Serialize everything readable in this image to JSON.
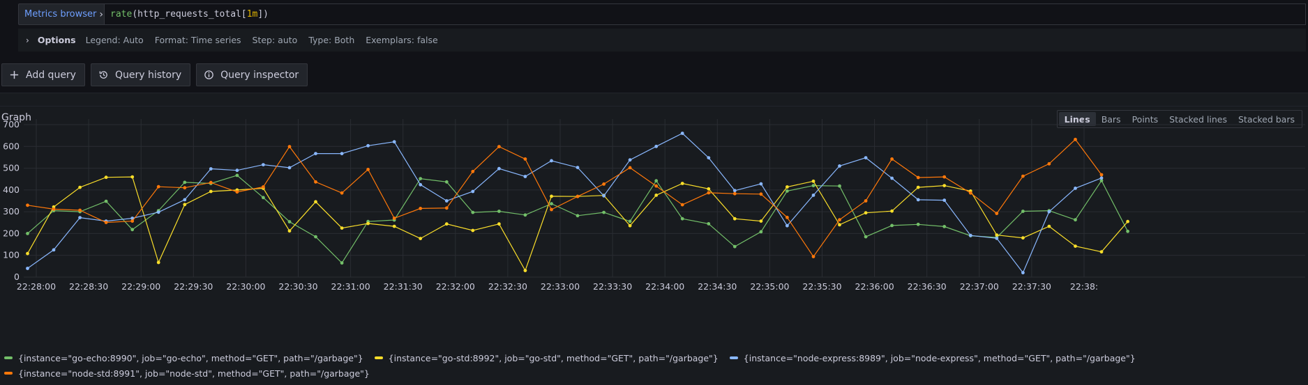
{
  "query": {
    "metrics_browser_label": "Metrics browser",
    "expr_fn": "rate",
    "expr_open": "(http_requests_total[",
    "expr_num": "1m",
    "expr_close": "])"
  },
  "options": {
    "title": "Options",
    "legend": "Legend: Auto",
    "format": "Format: Time series",
    "step": "Step: auto",
    "type": "Type: Both",
    "exemplars": "Exemplars: false"
  },
  "buttons": {
    "add_query": "Add query",
    "query_history": "Query history",
    "query_inspector": "Query inspector"
  },
  "graph": {
    "title": "Graph",
    "modes": [
      "Lines",
      "Bars",
      "Points",
      "Stacked lines",
      "Stacked bars"
    ],
    "active_mode": "Lines"
  },
  "colors": {
    "green": "#73bf69",
    "yellow": "#fade2a",
    "blue": "#8ab8ff",
    "orange": "#ff780a"
  },
  "chart_data": {
    "type": "line",
    "ylim": [
      0,
      700
    ],
    "yticks": [
      0,
      100,
      200,
      300,
      400,
      500,
      600,
      700
    ],
    "x_start": "22:27:55",
    "x_step_seconds": 15,
    "xtick_labels": [
      "22:28:00",
      "22:28:30",
      "22:29:00",
      "22:29:30",
      "22:30:00",
      "22:30:30",
      "22:31:00",
      "22:31:30",
      "22:32:00",
      "22:32:30",
      "22:33:00",
      "22:33:30",
      "22:34:00",
      "22:34:30",
      "22:35:00",
      "22:35:30",
      "22:36:00",
      "22:36:30",
      "22:37:00",
      "22:37:30",
      "22:38:00"
    ],
    "xtick_display": [
      "22:28:00",
      "22:28:30",
      "22:29:00",
      "22:29:30",
      "22:30:00",
      "22:30:30",
      "22:31:00",
      "22:31:30",
      "22:32:00",
      "22:32:30",
      "22:33:00",
      "22:33:30",
      "22:34:00",
      "22:34:30",
      "22:35:00",
      "22:35:30",
      "22:36:00",
      "22:36:30",
      "22:37:00",
      "22:37:30",
      "22:38:"
    ],
    "grid": true,
    "legend_position": "bottom",
    "series": [
      {
        "name": "{instance=\"go-echo:8990\", job=\"go-echo\", method=\"GET\", path=\"/garbage\"}",
        "color": "#73bf69",
        "values": [
          200,
          305,
          300,
          348,
          218,
          305,
          435,
          430,
          467,
          365,
          254,
          185,
          65,
          255,
          262,
          452,
          437,
          297,
          302,
          285,
          337,
          282,
          297,
          256,
          442,
          268,
          245,
          140,
          208,
          395,
          420,
          418,
          185,
          237,
          242,
          232,
          190,
          182,
          302,
          305,
          263,
          443,
          210
        ]
      },
      {
        "name": "{instance=\"go-std:8992\", job=\"go-std\", method=\"GET\", path=\"/garbage\"}",
        "color": "#fade2a",
        "values": [
          108,
          322,
          412,
          458,
          460,
          67,
          333,
          393,
          400,
          408,
          212,
          346,
          225,
          246,
          233,
          177,
          244,
          214,
          244,
          30,
          371,
          370,
          375,
          236,
          376,
          430,
          405,
          268,
          257,
          414,
          440,
          240,
          295,
          303,
          412,
          420,
          395,
          193,
          180,
          233,
          142,
          116,
          255
        ]
      },
      {
        "name": "{instance=\"node-express:8989\", job=\"node-express\", method=\"GET\", path=\"/garbage\"}",
        "color": "#8ab8ff",
        "values": [
          40,
          125,
          273,
          257,
          270,
          298,
          355,
          497,
          490,
          516,
          502,
          567,
          567,
          603,
          621,
          424,
          350,
          393,
          498,
          462,
          534,
          503,
          373,
          538,
          600,
          660,
          548,
          397,
          428,
          236,
          376,
          510,
          548,
          454,
          355,
          353,
          191,
          178,
          20,
          300,
          408,
          455
        ]
      },
      {
        "name": "{instance=\"node-std:8991\", job=\"node-std\", method=\"GET\", path=\"/garbage\"}",
        "color": "#ff780a",
        "values": [
          330,
          312,
          307,
          251,
          257,
          415,
          410,
          434,
          391,
          414,
          599,
          437,
          386,
          494,
          270,
          315,
          317,
          485,
          599,
          542,
          310,
          370,
          427,
          502,
          418,
          332,
          387,
          383,
          381,
          274,
          94,
          263,
          350,
          542,
          457,
          460,
          386,
          292,
          463,
          520,
          632,
          470
        ]
      }
    ]
  }
}
